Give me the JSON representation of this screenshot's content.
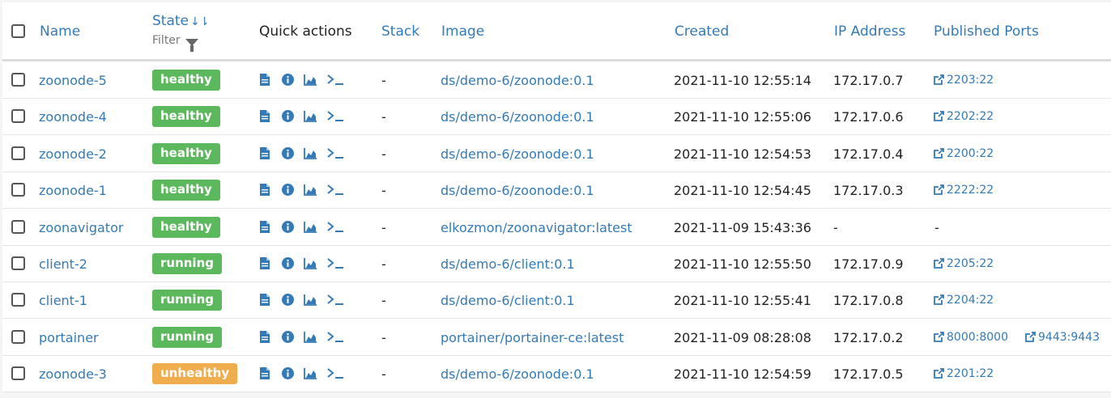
{
  "header": {
    "name": "Name",
    "state": "State",
    "state_sort": "↓⇂",
    "filter": "Filter",
    "quick_actions": "Quick actions",
    "stack": "Stack",
    "image": "Image",
    "created": "Created",
    "ip": "IP Address",
    "ports": "Published Ports"
  },
  "colors": {
    "link": "#337ab7",
    "healthy": "#5cb85c",
    "running": "#5cb85c",
    "unhealthy": "#f0ad4e"
  },
  "quick_action_icons": [
    "file-icon",
    "info-icon",
    "stats-icon",
    "console-icon"
  ],
  "rows": [
    {
      "name": "zoonode-5",
      "state": "healthy",
      "stack": "-",
      "image": "ds/demo-6/zoonode:0.1",
      "created": "2021-11-10 12:55:14",
      "ip": "172.17.0.7",
      "ports": [
        "2203:22"
      ]
    },
    {
      "name": "zoonode-4",
      "state": "healthy",
      "stack": "-",
      "image": "ds/demo-6/zoonode:0.1",
      "created": "2021-11-10 12:55:06",
      "ip": "172.17.0.6",
      "ports": [
        "2202:22"
      ]
    },
    {
      "name": "zoonode-2",
      "state": "healthy",
      "stack": "-",
      "image": "ds/demo-6/zoonode:0.1",
      "created": "2021-11-10 12:54:53",
      "ip": "172.17.0.4",
      "ports": [
        "2200:22"
      ]
    },
    {
      "name": "zoonode-1",
      "state": "healthy",
      "stack": "-",
      "image": "ds/demo-6/zoonode:0.1",
      "created": "2021-11-10 12:54:45",
      "ip": "172.17.0.3",
      "ports": [
        "2222:22"
      ]
    },
    {
      "name": "zoonavigator",
      "state": "healthy",
      "stack": "-",
      "image": "elkozmon/zoonavigator:latest",
      "created": "2021-11-09 15:43:36",
      "ip": "-",
      "ports_text": "-",
      "ports": []
    },
    {
      "name": "client-2",
      "state": "running",
      "stack": "-",
      "image": "ds/demo-6/client:0.1",
      "created": "2021-11-10 12:55:50",
      "ip": "172.17.0.9",
      "ports": [
        "2205:22"
      ]
    },
    {
      "name": "client-1",
      "state": "running",
      "stack": "-",
      "image": "ds/demo-6/client:0.1",
      "created": "2021-11-10 12:55:41",
      "ip": "172.17.0.8",
      "ports": [
        "2204:22"
      ]
    },
    {
      "name": "portainer",
      "state": "running",
      "stack": "-",
      "image": "portainer/portainer-ce:latest",
      "created": "2021-11-09 08:28:08",
      "ip": "172.17.0.2",
      "ports": [
        "8000:8000",
        "9443:9443"
      ]
    },
    {
      "name": "zoonode-3",
      "state": "unhealthy",
      "stack": "-",
      "image": "ds/demo-6/zoonode:0.1",
      "created": "2021-11-10 12:54:59",
      "ip": "172.17.0.5",
      "ports": [
        "2201:22"
      ]
    }
  ]
}
